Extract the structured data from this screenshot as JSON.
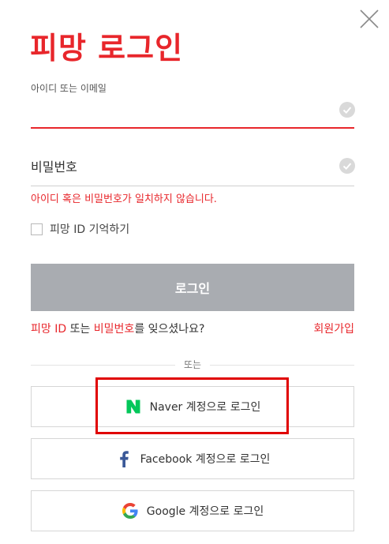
{
  "header": {
    "title": "피망 로그인",
    "close_icon": "close-icon"
  },
  "form": {
    "id_label": "아이디 또는 이메일",
    "id_value": "",
    "password_placeholder": "비밀번호",
    "error_message": "아이디 혹은 비밀번호가 일치하지 않습니다.",
    "remember_label": "피망 ID 기억하기",
    "login_button": "로그인"
  },
  "links": {
    "forgot_part1": "피망 ID",
    "forgot_part2": " 또는 ",
    "forgot_part3": "비밀번호",
    "forgot_part4": "를 잊으셨나요?",
    "signup": "회원가입"
  },
  "divider_text": "또는",
  "social": {
    "naver": {
      "label": "Naver 계정으로 로그인",
      "icon": "naver-icon"
    },
    "facebook": {
      "label": "Facebook 계정으로 로그인",
      "icon": "facebook-icon"
    },
    "google": {
      "label": "Google 계정으로 로그인",
      "icon": "google-icon"
    }
  },
  "colors": {
    "accent": "#e8262b",
    "login_button_bg": "#a9acb1",
    "naver_green": "#03c75a",
    "facebook_blue": "#3b5998",
    "highlight": "#e00000"
  }
}
